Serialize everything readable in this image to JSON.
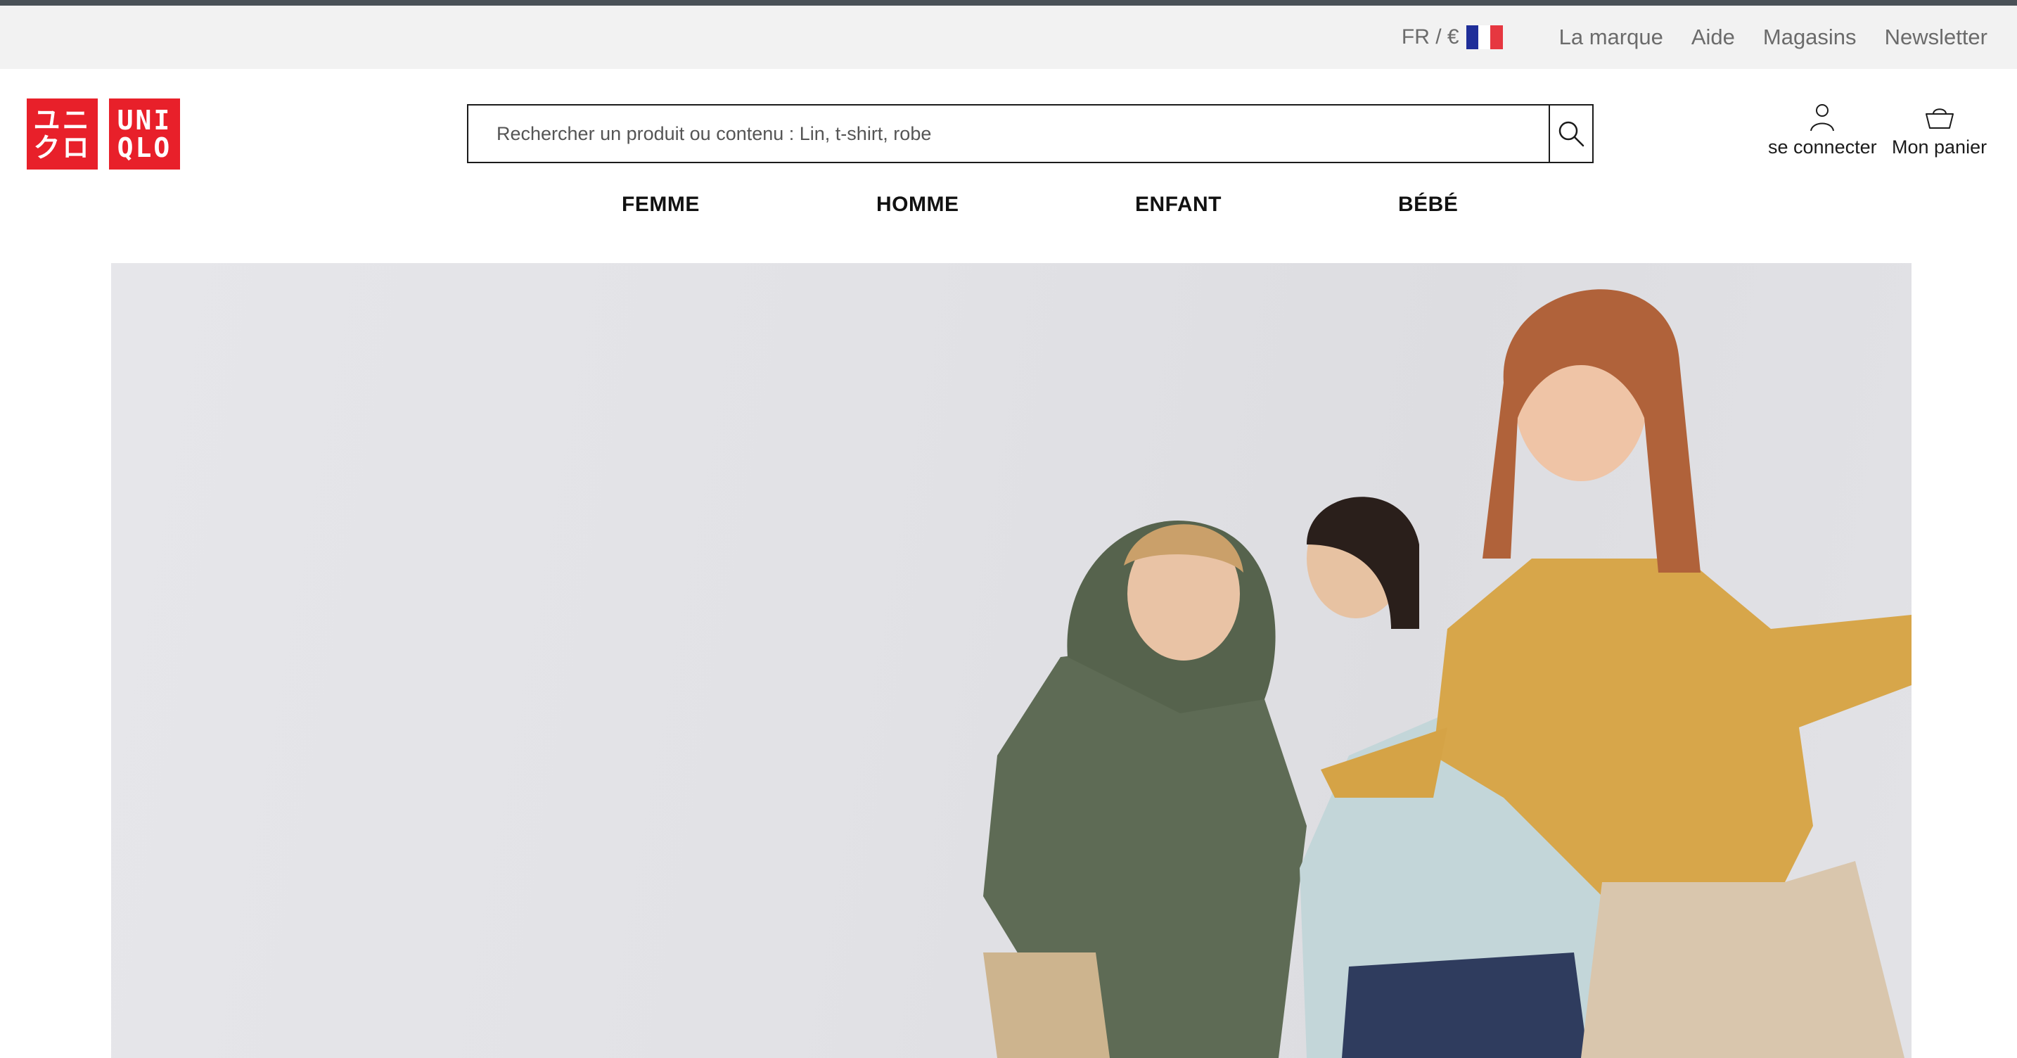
{
  "utility": {
    "lang": "FR / €",
    "links": [
      "La marque",
      "Aide",
      "Magasins",
      "Newsletter"
    ]
  },
  "logo": {
    "kana_lines": [
      "ユニ",
      "クロ"
    ],
    "latin_lines": [
      "UNI",
      "QLO"
    ]
  },
  "search": {
    "placeholder": "Rechercher un produit ou contenu : Lin, t-shirt, robe"
  },
  "account": {
    "login_label": "se connecter",
    "cart_label": "Mon panier"
  },
  "nav": {
    "items": [
      "FEMME",
      "HOMME",
      "ENFANT",
      "BÉBÉ"
    ]
  },
  "colors": {
    "brand_red": "#e8202a",
    "flag_blue": "#1f2e99",
    "flag_red": "#e63740"
  },
  "icons": {
    "search": "magnifier-icon",
    "login": "user-icon",
    "cart": "basket-icon"
  }
}
